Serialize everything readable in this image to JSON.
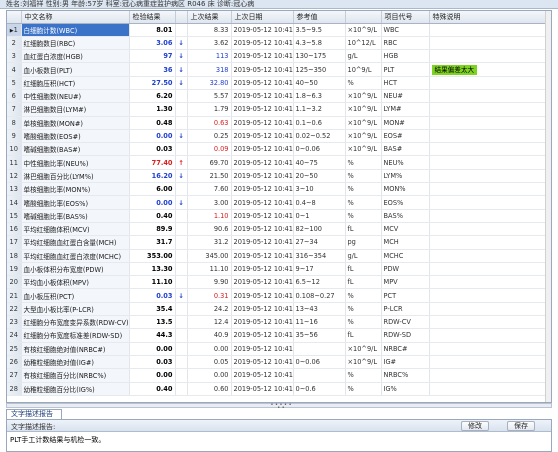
{
  "topbar": {
    "text": "姓名:刘福祥  性别:男  年龄:57岁  科室:冠心病重症监护病区  R046 床  诊断:冠心病"
  },
  "columns": {
    "name": "中文名称",
    "result": "检验结果",
    "prev": "上次结果",
    "date": "上次日期",
    "ref": "参考值",
    "code": "项目代号",
    "note": "特殊说明"
  },
  "rows": [
    {
      "n": "1",
      "name": "白细胞计数(WBC)",
      "result": "8.01",
      "flag": "",
      "prev": "8.33",
      "date": "2019-05-12 10:41",
      "ref": "3.5~9.5",
      "unit": "×10^9/L",
      "code": "WBC",
      "note": ""
    },
    {
      "n": "2",
      "name": "红细胞数目(RBC)",
      "result": "3.06",
      "flag": "↓",
      "prev": "3.62",
      "date": "2019-05-12 10:41",
      "ref": "4.3~5.8",
      "unit": "10^12/L",
      "code": "RBC",
      "note": ""
    },
    {
      "n": "3",
      "name": "血红蛋白浓度(HGB)",
      "result": "97",
      "flag": "↓",
      "prev": "113",
      "date": "2019-05-12 10:41",
      "ref": "130~175",
      "unit": "g/L",
      "code": "HGB",
      "note": ""
    },
    {
      "n": "4",
      "name": "血小板数目(PLT)",
      "result": "36",
      "flag": "↓",
      "prev": "318",
      "date": "2019-05-12 10:41",
      "ref": "125~350",
      "unit": "10^9/L",
      "code": "PLT",
      "note": "结果偏差太大"
    },
    {
      "n": "5",
      "name": "红细胞压积(HCT)",
      "result": "27.50",
      "flag": "↓",
      "prev": "32.80",
      "date": "2019-05-12 10:41",
      "ref": "40~50",
      "unit": "%",
      "code": "HCT",
      "note": ""
    },
    {
      "n": "6",
      "name": "中性细胞数(NEU#)",
      "result": "6.20",
      "flag": "",
      "prev": "5.57",
      "date": "2019-05-12 10:41",
      "ref": "1.8~6.3",
      "unit": "×10^9/L",
      "code": "NEU#",
      "note": ""
    },
    {
      "n": "7",
      "name": "淋巴细胞数目(LYM#)",
      "result": "1.30",
      "flag": "",
      "prev": "1.79",
      "date": "2019-05-12 10:41",
      "ref": "1.1~3.2",
      "unit": "×10^9/L",
      "code": "LYM#",
      "note": ""
    },
    {
      "n": "8",
      "name": "单核细胞数(MON#)",
      "result": "0.48",
      "flag": "",
      "prev": "0.63",
      "date": "2019-05-12 10:41",
      "ref": "0.1~0.6",
      "unit": "×10^9/L",
      "code": "MON#",
      "note": ""
    },
    {
      "n": "9",
      "name": "嗜酸细胞数(EOS#)",
      "result": "0.00",
      "flag": "↓",
      "prev": "0.25",
      "date": "2019-05-12 10:41",
      "ref": "0.02~0.52",
      "unit": "×10^9/L",
      "code": "EOS#",
      "note": ""
    },
    {
      "n": "10",
      "name": "嗜碱细胞数(BAS#)",
      "result": "0.03",
      "flag": "",
      "prev": "0.09",
      "date": "2019-05-12 10:41",
      "ref": "0~0.06",
      "unit": "×10^9/L",
      "code": "BAS#",
      "note": ""
    },
    {
      "n": "11",
      "name": "中性细胞比率(NEU%)",
      "result": "77.40",
      "flag": "↑",
      "prev": "69.70",
      "date": "2019-05-12 10:41",
      "ref": "40~75",
      "unit": "%",
      "code": "NEU%",
      "note": ""
    },
    {
      "n": "12",
      "name": "淋巴细胞百分比(LYM%)",
      "result": "16.20",
      "flag": "↓",
      "prev": "21.50",
      "date": "2019-05-12 10:41",
      "ref": "20~50",
      "unit": "%",
      "code": "LYM%",
      "note": ""
    },
    {
      "n": "13",
      "name": "单核细胞比率(MON%)",
      "result": "6.00",
      "flag": "",
      "prev": "7.60",
      "date": "2019-05-12 10:41",
      "ref": "3~10",
      "unit": "%",
      "code": "MON%",
      "note": ""
    },
    {
      "n": "14",
      "name": "嗜酸细胞比率(EOS%)",
      "result": "0.00",
      "flag": "↓",
      "prev": "3.00",
      "date": "2019-05-12 10:41",
      "ref": "0.4~8",
      "unit": "%",
      "code": "EOS%",
      "note": ""
    },
    {
      "n": "15",
      "name": "嗜碱细胞比率(BAS%)",
      "result": "0.40",
      "flag": "",
      "prev": "1.10",
      "date": "2019-05-12 10:41",
      "ref": "0~1",
      "unit": "%",
      "code": "BAS%",
      "note": ""
    },
    {
      "n": "16",
      "name": "平均红细胞体积(MCV)",
      "result": "89.9",
      "flag": "",
      "prev": "90.6",
      "date": "2019-05-12 10:41",
      "ref": "82~100",
      "unit": "fL",
      "code": "MCV",
      "note": ""
    },
    {
      "n": "17",
      "name": "平均红细胞血红蛋白含量(MCH)",
      "result": "31.7",
      "flag": "",
      "prev": "31.2",
      "date": "2019-05-12 10:41",
      "ref": "27~34",
      "unit": "pg",
      "code": "MCH",
      "note": ""
    },
    {
      "n": "18",
      "name": "平均红细胞血红蛋白浓度(MCHC)",
      "result": "353.00",
      "flag": "",
      "prev": "345.00",
      "date": "2019-05-12 10:41",
      "ref": "316~354",
      "unit": "g/L",
      "code": "MCHC",
      "note": ""
    },
    {
      "n": "19",
      "name": "血小板体积分布宽度(PDW)",
      "result": "13.30",
      "flag": "",
      "prev": "11.10",
      "date": "2019-05-12 10:41",
      "ref": "9~17",
      "unit": "fL",
      "code": "PDW",
      "note": ""
    },
    {
      "n": "20",
      "name": "平均血小板体积(MPV)",
      "result": "11.10",
      "flag": "",
      "prev": "9.90",
      "date": "2019-05-12 10:41",
      "ref": "6.5~12",
      "unit": "fL",
      "code": "MPV",
      "note": ""
    },
    {
      "n": "21",
      "name": "血小板压积(PCT)",
      "result": "0.03",
      "flag": "↓",
      "prev": "0.31",
      "date": "2019-05-12 10:41",
      "ref": "0.108~0.27",
      "unit": "%",
      "code": "PCT",
      "note": ""
    },
    {
      "n": "22",
      "name": "大型血小板比率(P-LCR)",
      "result": "35.4",
      "flag": "",
      "prev": "24.2",
      "date": "2019-05-12 10:41",
      "ref": "13~43",
      "unit": "%",
      "code": "P-LCR",
      "note": ""
    },
    {
      "n": "23",
      "name": "红细胞分布宽度变异系数(RDW-CV)",
      "result": "13.5",
      "flag": "",
      "prev": "12.4",
      "date": "2019-05-12 10:41",
      "ref": "11~16",
      "unit": "%",
      "code": "RDW-CV",
      "note": ""
    },
    {
      "n": "24",
      "name": "红细胞分布宽度标准差(RDW-SD)",
      "result": "44.3",
      "flag": "",
      "prev": "40.9",
      "date": "2019-05-12 10:41",
      "ref": "35~56",
      "unit": "fL",
      "code": "RDW-SD",
      "note": ""
    },
    {
      "n": "25",
      "name": "有核红细胞绝对值(NRBC#)",
      "result": "0.00",
      "flag": "",
      "prev": "0.00",
      "date": "2019-05-12 10:41",
      "ref": "",
      "unit": "×10^9/L",
      "code": "NRBC#",
      "note": ""
    },
    {
      "n": "26",
      "name": "幼稚粒细胞绝对值(IG#)",
      "result": "0.03",
      "flag": "",
      "prev": "0.05",
      "date": "2019-05-12 10:41",
      "ref": "0~0.06",
      "unit": "×10^9/L",
      "code": "IG#",
      "note": ""
    },
    {
      "n": "27",
      "name": "有核红细胞百分比(NRBC%)",
      "result": "0.00",
      "flag": "",
      "prev": "0.00",
      "date": "2019-05-12 10:41",
      "ref": "",
      "unit": "%",
      "code": "NRBC%",
      "note": ""
    },
    {
      "n": "28",
      "name": "幼稚粒细胞百分比(IG%)",
      "result": "0.40",
      "flag": "",
      "prev": "0.60",
      "date": "2019-05-12 10:41",
      "ref": "0~0.6",
      "unit": "%",
      "code": "IG%",
      "note": ""
    }
  ],
  "selected_row": "1",
  "selected_marker": "▶",
  "panel": {
    "tab": "文字描述报告",
    "bar_label": "文字描述报告:",
    "modify_button": "修改",
    "save_button": "保存",
    "text": "PLT手工计数结果与机检一致。"
  },
  "scroll_grip": "• • • • • • •",
  "colors": {
    "flag_low": "#1f3fcf",
    "flag_high": "#d81e1e",
    "note_badge": "#7ed321",
    "selected_name": "#3b73c8"
  }
}
